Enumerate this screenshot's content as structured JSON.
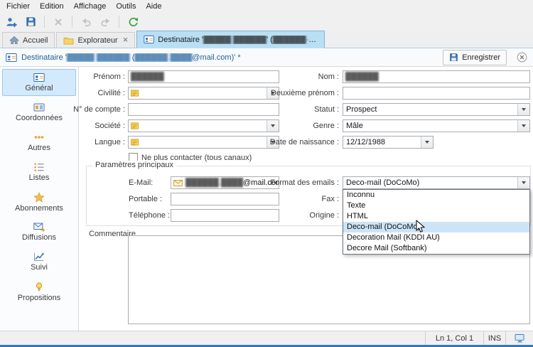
{
  "colors": {
    "accent_blue": "#2a6db5",
    "tab_active_bg": "#b9dff4",
    "sidebar_selected_bg": "#d3eafc",
    "refresh_green": "#35a035",
    "folder_yellow": "#f8d464",
    "window_edge_blue": "#3178be"
  },
  "menu": {
    "items": [
      {
        "label": "Fichier"
      },
      {
        "label": "Edition"
      },
      {
        "label": "Affichage"
      },
      {
        "label": "Outils"
      },
      {
        "label": "Aide"
      }
    ]
  },
  "toolbar": {
    "buttons": [
      "add-contact",
      "save",
      "delete",
      "undo",
      "redo",
      "refresh"
    ]
  },
  "tabs": {
    "accueil": "Accueil",
    "explorateur": "Explorateur",
    "destinataire": {
      "prefix": "Destinataire '",
      "name": "█████ ██████",
      "mid": "' (",
      "email": "██████-███",
      "suffix": "..."
    }
  },
  "doc_header": {
    "title": {
      "prefix": "Destinataire '",
      "name": "█████ ██████",
      "mid": " (",
      "email": "██████.████",
      "suffix": "@mail.com)' *"
    },
    "save_button": "Enregistrer"
  },
  "sidebar": {
    "items": [
      {
        "label": "Général",
        "selected": true
      },
      {
        "label": "Coordonnées",
        "selected": false
      },
      {
        "label": "Autres",
        "selected": false
      },
      {
        "label": "Listes",
        "selected": false
      },
      {
        "label": "Abonnements",
        "selected": false
      },
      {
        "label": "Diffusions",
        "selected": false
      },
      {
        "label": "Suivi",
        "selected": false
      },
      {
        "label": "Propositions",
        "selected": false
      }
    ]
  },
  "form": {
    "prenom": {
      "label": "Prénom :",
      "value": "██████"
    },
    "nom": {
      "label": "Nom :",
      "value": "██████"
    },
    "civilite": {
      "label": "Civilité :"
    },
    "deuxieme_prenom": {
      "label": "Deuxième prénom :",
      "value": ""
    },
    "compte": {
      "label": "N° de compte :",
      "value": ""
    },
    "statut": {
      "label": "Statut :",
      "value": "Prospect"
    },
    "societe": {
      "label": "Société :"
    },
    "genre": {
      "label": "Genre :",
      "value": "Mâle"
    },
    "langue": {
      "label": "Langue :"
    },
    "naissance": {
      "label": "Date de naissance :",
      "value": "12/12/1988"
    },
    "ne_plus_contacter": {
      "label": "Ne plus contacter (tous canaux)",
      "checked": false
    },
    "groupe": {
      "title": "Paramètres principaux"
    },
    "email": {
      "label": "E-Mail:",
      "redacted": "██████.████",
      "suffix": "@mail.com"
    },
    "format": {
      "label": "Format des emails :",
      "value": "Deco-mail (DoCoMo)"
    },
    "portable": {
      "label": "Portable :",
      "value": ""
    },
    "fax": {
      "label": "Fax :",
      "value": ""
    },
    "telephone": {
      "label": "Téléphone :",
      "value": ""
    },
    "origine": {
      "label": "Origine :",
      "value": ""
    },
    "commentaire": {
      "label": "Commentaire",
      "value": ""
    }
  },
  "format_dropdown": {
    "options": [
      {
        "label": "Inconnu"
      },
      {
        "label": "Texte"
      },
      {
        "label": "HTML"
      },
      {
        "label": "Deco-mail (DoCoMo)"
      },
      {
        "label": "Decoration Mail (KDDI AU)"
      },
      {
        "label": "Decore Mail (Softbank)"
      }
    ],
    "highlighted_index": 3
  },
  "statusbar": {
    "cursor_position": "Ln 1, Col 1",
    "insert_mode": "INS"
  }
}
